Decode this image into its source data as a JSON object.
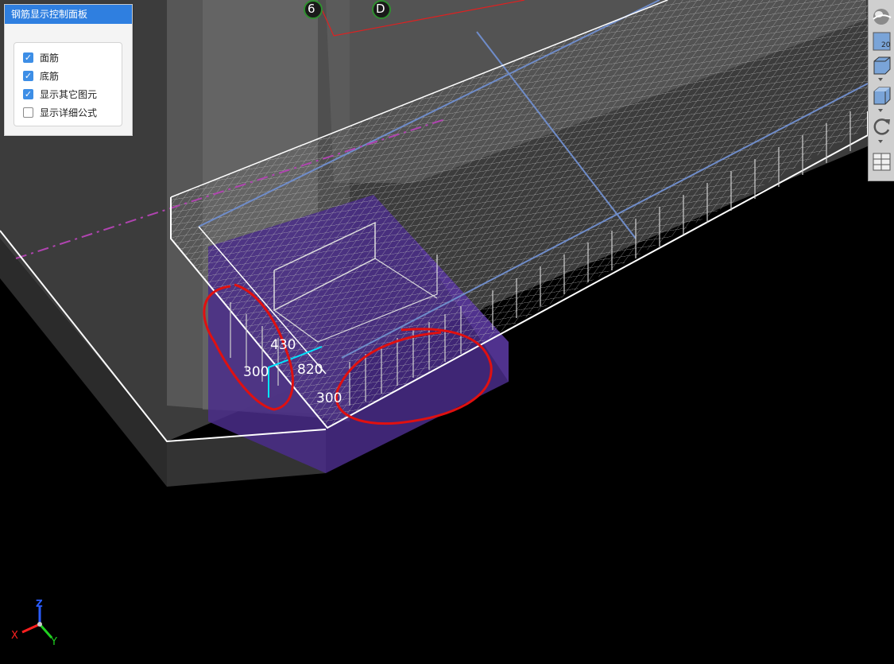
{
  "panel": {
    "title": "钢筋显示控制面板",
    "options": [
      {
        "label": "面筋",
        "checked": true
      },
      {
        "label": "底筋",
        "checked": true
      },
      {
        "label": "显示其它图元",
        "checked": true
      },
      {
        "label": "显示详细公式",
        "checked": false
      }
    ]
  },
  "grid_axes": {
    "axis_1": "6",
    "axis_2": "D"
  },
  "dimensions": {
    "d1": "430",
    "d2": "300",
    "d3": "820",
    "d4": "300"
  },
  "toolbar": {
    "level_badge": "20",
    "icons": [
      "sphere-view-icon",
      "2d-plan-icon",
      "box-view-icon",
      "cube-icon",
      "rotate-icon",
      "layout-icon"
    ]
  },
  "axes_gizmo": {
    "x": "X",
    "y": "Y",
    "z": "Z"
  },
  "colors": {
    "panel_header": "#2f7fe0",
    "checkbox_on": "#3d8ee6",
    "annotation_red": "#e01010",
    "purple_block": "#4a2d8a",
    "dim_line": "#00e5ff"
  }
}
